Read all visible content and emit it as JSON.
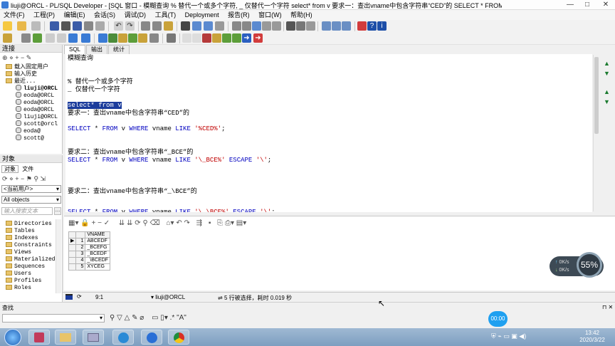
{
  "window": {
    "title": "liuji@ORCL - PL/SQL Developer - [SQL 窗口 - 模糊查询 % 替代一个或多个字符, _ 仅替代一个字符 select* from v 要求一：查出vname中包含字符串“CED”的 SELECT * FROM v WHERE vname LI...]",
    "minimize": "—",
    "maximize": "□",
    "close": "✕"
  },
  "menu": [
    "文件(F)",
    "工程(P)",
    "编辑(E)",
    "会话(S)",
    "调试(D)",
    "工具(T)",
    "Deployment",
    "报告(R)",
    "窗口(W)",
    "帮助(H)"
  ],
  "connections": {
    "header": "连接",
    "items": [
      {
        "label": "载入固定用户",
        "type": "folder"
      },
      {
        "label": "输入历史",
        "type": "folder"
      },
      {
        "label": "最近...",
        "type": "folder"
      },
      {
        "label": "liuji@ORCL",
        "type": "db",
        "bold": true
      },
      {
        "label": "eoda@ORCL",
        "type": "db"
      },
      {
        "label": "eoda@ORCL",
        "type": "db"
      },
      {
        "label": "eoda@ORCL",
        "type": "db"
      },
      {
        "label": "liuji@ORCL",
        "type": "db"
      },
      {
        "label": "scott@orcl",
        "type": "db"
      },
      {
        "label": "eoda@",
        "type": "db"
      },
      {
        "label": "scott@",
        "type": "db"
      }
    ]
  },
  "objects": {
    "header": "对象",
    "tabs": [
      "对象",
      "文件"
    ],
    "user_select": "<当前用户>",
    "filter_select": "All objects",
    "search_placeholder": "输入搜索文本",
    "items": [
      "Directories",
      "Tables",
      "Indexes",
      "Constraints",
      "Views",
      "Materialized",
      "Sequences",
      "Users",
      "Profiles",
      "Roles"
    ]
  },
  "editor": {
    "tabs": [
      "SQL",
      "输出",
      "统计"
    ],
    "lines": [
      {
        "text": "模糊查询",
        "kind": "plain"
      },
      {
        "text": "",
        "kind": "plain"
      },
      {
        "text": "",
        "kind": "plain"
      },
      {
        "text": "% 替代一个或多个字符",
        "kind": "plain"
      },
      {
        "text": "_ 仅替代一个字符",
        "kind": "plain"
      },
      {
        "text": "",
        "kind": "plain"
      },
      {
        "text": "select* from v",
        "kind": "selected"
      },
      {
        "text": "要求一：查出vname中包含字符串“CED”的",
        "kind": "plain"
      },
      {
        "text": "",
        "kind": "plain"
      },
      {
        "text": "SELECT * FROM v WHERE vname LIKE '%CED%';",
        "kind": "sql"
      },
      {
        "text": "",
        "kind": "plain"
      },
      {
        "text": "",
        "kind": "plain"
      },
      {
        "text": "要求二：查出vname中包含字符串“_BCE”的",
        "kind": "plain"
      },
      {
        "text": "SELECT * FROM v WHERE vname LIKE '\\_BCE%' ESCAPE '\\';",
        "kind": "sql"
      },
      {
        "text": "",
        "kind": "plain"
      },
      {
        "text": "",
        "kind": "plain"
      },
      {
        "text": "",
        "kind": "plain"
      },
      {
        "text": "要求二：查出vname中包含字符串“_\\BCE”的",
        "kind": "plain"
      }
    ],
    "cut_line": "SELECT * FROM v WHERE vname LIKE '\\_\\BCE%' ESCAPE '\\';"
  },
  "results": {
    "columns": [
      "",
      "",
      "VNAME"
    ],
    "rows": [
      [
        "▶",
        "1",
        "ABCEDF"
      ],
      [
        "",
        "2",
        "_BCEFG"
      ],
      [
        "",
        "3",
        "_BCEDF"
      ],
      [
        "",
        "4",
        "_\\BCEDF"
      ],
      [
        "",
        "5",
        "XYCEG"
      ]
    ]
  },
  "status": {
    "position": "9:1",
    "connection": "liuji@ORCL",
    "message": "5 行被选择，耗时 0.019 秒"
  },
  "find_bar": {
    "label": "查找"
  },
  "net_widget": {
    "up": "0K/s",
    "down": "0K/s",
    "percent": "55%"
  },
  "bubble": "00:00",
  "clock": {
    "time": "13:42",
    "date": "2020/3/22"
  },
  "colors": {
    "keyword": "#0000c0",
    "string": "#c00000",
    "selection": "#1b3c9c"
  }
}
